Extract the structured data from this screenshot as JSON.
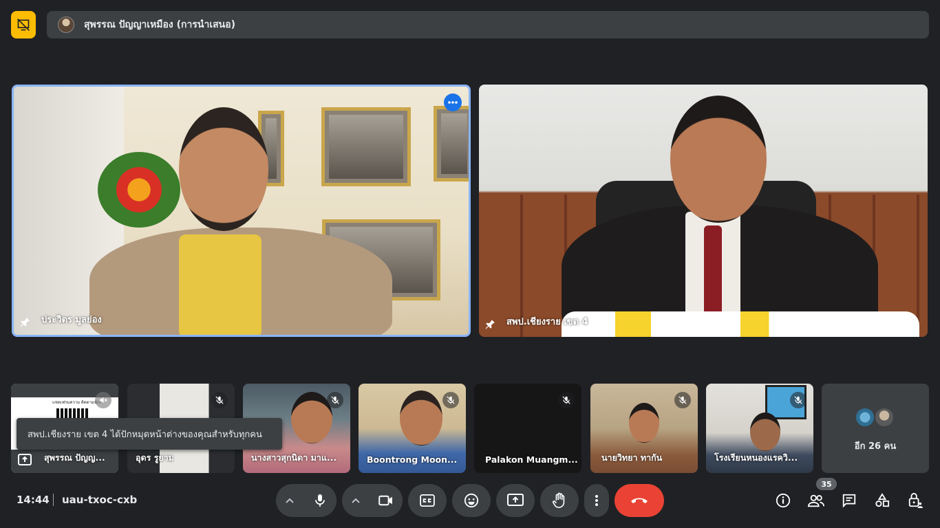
{
  "presenter": {
    "name": "สุพรรณ ปัญญาเหมือง (การนำเสนอ)"
  },
  "main_tiles": [
    {
      "name": "ประวิตร มูลย่อง"
    },
    {
      "name": "สพป.เชียงราย เขต 4"
    }
  ],
  "strip": [
    {
      "name": "สุพรรณ ปัญญ...",
      "qr_text": "แชตเฟรมความ ติดตามนักเ"
    },
    {
      "name": "อุดร รูยาม"
    },
    {
      "name": "นางสาวสุกนิดา มาแ..."
    },
    {
      "name": "Boontrong Moon..."
    },
    {
      "name": "Palakon Muangm..."
    },
    {
      "name": "นายวิทยา ทากัน"
    },
    {
      "name": "โรงเรียนหนองแรควิ..."
    }
  ],
  "more": {
    "label": "อีก 26 คน"
  },
  "toast": {
    "text": "สพป.เชียงราย เขต 4 ได้ปักหมุดหน้าต่างของคุณสำหรับทุกคน"
  },
  "bottom": {
    "time": "14:44",
    "meeting_code": "uau-txoc-cxb",
    "participants_count": "35"
  },
  "colors": {
    "accent": "#8ab4f8",
    "end_call": "#ea4335",
    "presenting": "#fbbc04",
    "bar": "#3c4043"
  }
}
